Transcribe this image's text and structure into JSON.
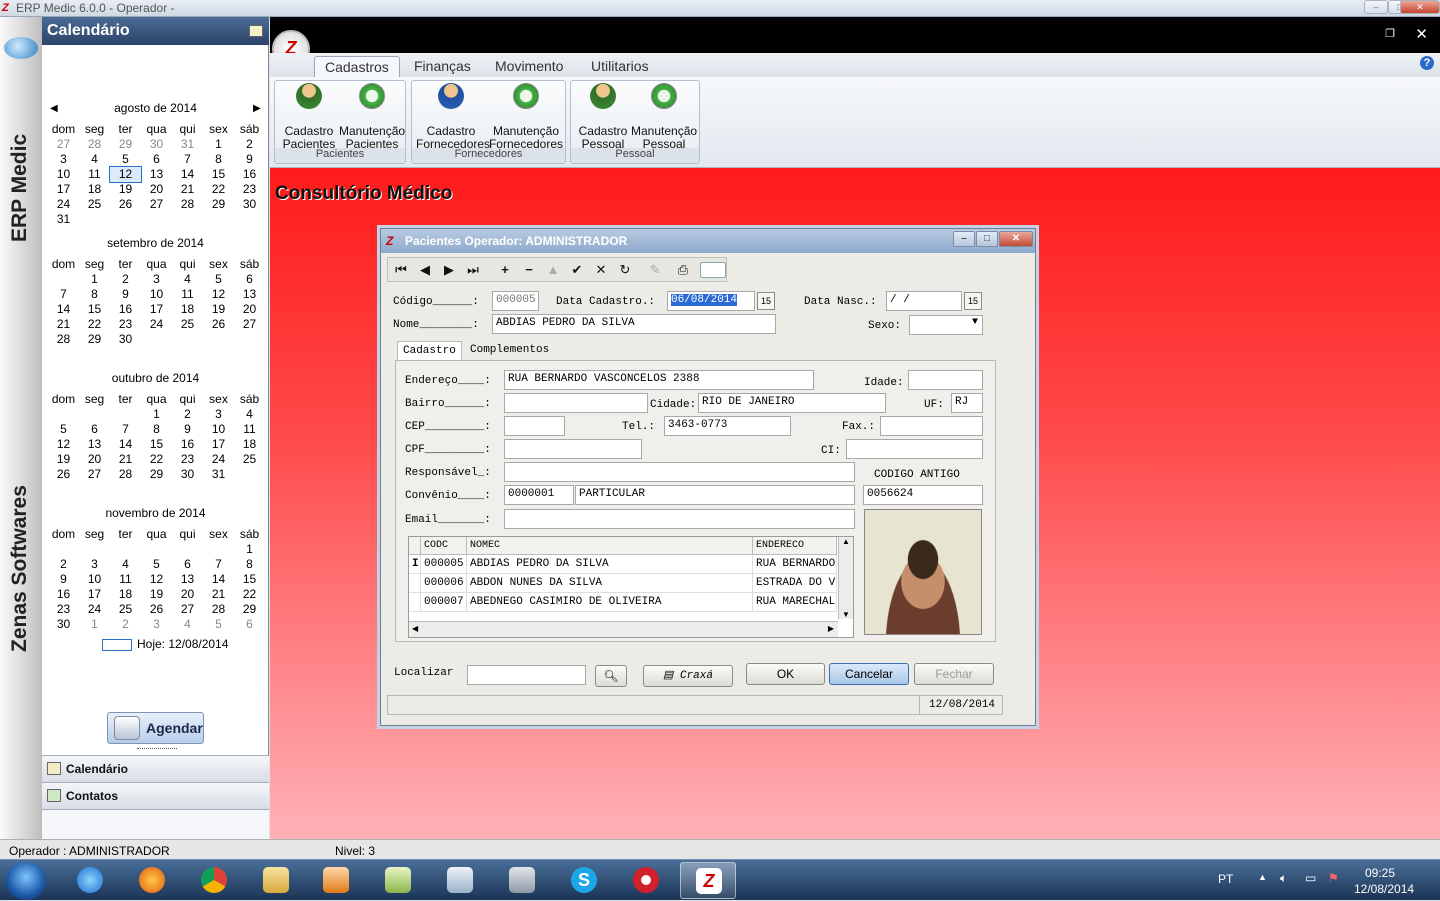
{
  "window": {
    "title": "ERP Medic  6.0.0 - Operador -"
  },
  "brand": {
    "top": "ERP Medic",
    "bottom": "Zenas Softwares"
  },
  "calendar": {
    "title": "Calendário",
    "months": [
      {
        "name": "agosto de 2014",
        "rows": [
          [
            "27",
            "28",
            "29",
            "30",
            "31",
            "1",
            "2"
          ],
          [
            "3",
            "4",
            "5",
            "6",
            "7",
            "8",
            "9"
          ],
          [
            "10",
            "11",
            "12",
            "13",
            "14",
            "15",
            "16"
          ],
          [
            "17",
            "18",
            "19",
            "20",
            "21",
            "22",
            "23"
          ],
          [
            "24",
            "25",
            "26",
            "27",
            "28",
            "29",
            "30"
          ],
          [
            "31",
            "",
            "",
            "",
            "",
            "",
            ""
          ]
        ]
      },
      {
        "name": "setembro de 2014",
        "rows": [
          [
            "",
            "1",
            "2",
            "3",
            "4",
            "5",
            "6"
          ],
          [
            "7",
            "8",
            "9",
            "10",
            "11",
            "12",
            "13"
          ],
          [
            "14",
            "15",
            "16",
            "17",
            "18",
            "19",
            "20"
          ],
          [
            "21",
            "22",
            "23",
            "24",
            "25",
            "26",
            "27"
          ],
          [
            "28",
            "29",
            "30",
            "",
            "",
            "",
            ""
          ]
        ]
      },
      {
        "name": "outubro de 2014",
        "rows": [
          [
            "",
            "",
            "",
            "1",
            "2",
            "3",
            "4"
          ],
          [
            "5",
            "6",
            "7",
            "8",
            "9",
            "10",
            "11"
          ],
          [
            "12",
            "13",
            "14",
            "15",
            "16",
            "17",
            "18"
          ],
          [
            "19",
            "20",
            "21",
            "22",
            "23",
            "24",
            "25"
          ],
          [
            "26",
            "27",
            "28",
            "29",
            "30",
            "31",
            ""
          ]
        ]
      },
      {
        "name": "novembro de 2014",
        "rows": [
          [
            "",
            "",
            "",
            "",
            "",
            "",
            "1"
          ],
          [
            "2",
            "3",
            "4",
            "5",
            "6",
            "7",
            "8"
          ],
          [
            "9",
            "10",
            "11",
            "12",
            "13",
            "14",
            "15"
          ],
          [
            "16",
            "17",
            "18",
            "19",
            "20",
            "21",
            "22"
          ],
          [
            "23",
            "24",
            "25",
            "26",
            "27",
            "28",
            "29"
          ],
          [
            "30",
            "1",
            "2",
            "3",
            "4",
            "5",
            "6"
          ]
        ]
      }
    ],
    "weekdays": [
      "dom",
      "seg",
      "ter",
      "qua",
      "qui",
      "sex",
      "sáb"
    ],
    "today_label": "Hoje: 12/08/2014",
    "schedule_button": "Agendar",
    "nav": [
      "Calendário",
      "Contatos"
    ]
  },
  "ribbon": {
    "tabs": [
      "Cadastros",
      "Finanças",
      "Movimento",
      "Utilitarios"
    ],
    "groups": [
      {
        "label": "Pacientes",
        "buttons": [
          {
            "l1": "Cadastro",
            "l2": "Pacientes",
            "icon": "patient-icon"
          },
          {
            "l1": "Manutenção",
            "l2": "Pacientes",
            "icon": "maintenance-icon"
          }
        ]
      },
      {
        "label": "Fornecedores",
        "buttons": [
          {
            "l1": "Cadastro",
            "l2": "Fornecedores",
            "icon": "supplier-icon"
          },
          {
            "l1": "Manutenção",
            "l2": "Fornecedores",
            "icon": "maintenance-icon"
          }
        ]
      },
      {
        "label": "Pessoal",
        "buttons": [
          {
            "l1": "Cadastro",
            "l2": "Pessoal",
            "icon": "staff-icon"
          },
          {
            "l1": "Manutenção",
            "l2": "Pessoal",
            "icon": "maintenance-icon"
          }
        ]
      }
    ]
  },
  "main": {
    "heading": "Consultório Médico"
  },
  "dialog": {
    "title": "Pacientes Operador: ADMINISTRADOR",
    "fields": {
      "codigo_label": "Código______:",
      "codigo": "000005",
      "data_cad_label": "Data Cadastro.:",
      "data_cad": "06/08/2014",
      "data_nasc_label": "Data Nasc.:",
      "data_nasc": " /  /",
      "nome_label": "Nome________:",
      "nome": "ABDIAS PEDRO DA SILVA",
      "sexo_label": "Sexo:",
      "endereco_label": "Endereço____:",
      "endereco": "RUA BERNARDO VASCONCELOS 2388",
      "idade_label": "Idade:",
      "bairro_label": "Bairro______:",
      "cidade_label": "Cidade:",
      "cidade": "RIO DE JANEIRO",
      "uf_label": "UF:",
      "uf": "RJ",
      "cep_label": "CEP_________:",
      "tel_label": "Tel.:",
      "tel": "3463-0773",
      "fax_label": "Fax.:",
      "cpf_label": "CPF_________:",
      "ci_label": "CI:",
      "resp_label": "Responsável_:",
      "convenio_label": "Convênio____:",
      "convenio_cod": "0000001",
      "convenio_nome": "PARTICULAR",
      "cod_antigo_label": "CODIGO ANTIGO",
      "cod_antigo": "0056624",
      "email_label": "Email_______:"
    },
    "tabs": [
      "Cadastro",
      "Complementos"
    ],
    "grid": {
      "columns": [
        "CODC",
        "NOMEC",
        "ENDERECO"
      ],
      "rows": [
        [
          "000005",
          "ABDIAS PEDRO DA SILVA",
          "RUA BERNARDO"
        ],
        [
          "000006",
          "ABDON NUNES DA SILVA",
          "ESTRADA DO V"
        ],
        [
          "000007",
          "ABEDNEGO CASIMIRO DE OLIVEIRA",
          "RUA MARECHAL"
        ]
      ]
    },
    "localizar_label": "Localizar",
    "buttons": {
      "craxa": "Craxá",
      "ok": "OK",
      "cancelar": "Cancelar",
      "fechar": "Fechar"
    },
    "status_date": "12/08/2014"
  },
  "statusbar": {
    "operador": "Operador :  ADMINISTRADOR",
    "nivel": "Nivel:  3"
  },
  "taskbar": {
    "lang": "PT",
    "time": "09:25",
    "date": "12/08/2014"
  }
}
